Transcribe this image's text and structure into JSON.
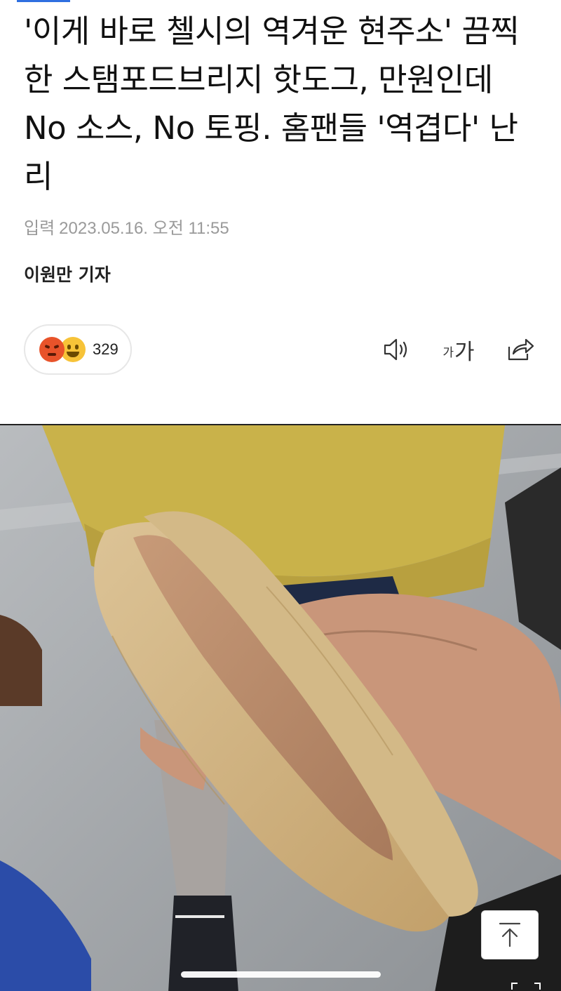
{
  "article": {
    "headline": "'이게 바로 첼시의 역겨운 현주소' 끔찍한 스탬포드브리지 핫도그, 만원인데 No 소스, No 토핑. 홈팬들 '역겹다' 난리",
    "date_label": "입력",
    "date_value": "2023.05.16. 오전 11:55",
    "byline": "이원만 기자"
  },
  "reactions": {
    "count": "329",
    "icons": [
      "angry-emoji",
      "laughing-emoji"
    ]
  },
  "toolbar": {
    "audio_icon": "speaker-icon",
    "font_small": "가",
    "font_big": "가",
    "share_icon": "share-icon"
  },
  "photo": {
    "subject": "hot-dog-photo"
  },
  "colors": {
    "accent": "#2f6fe0",
    "meta_text": "#9a9a9a",
    "angry_emoji": "#e8532a",
    "laugh_emoji": "#f7c338"
  }
}
